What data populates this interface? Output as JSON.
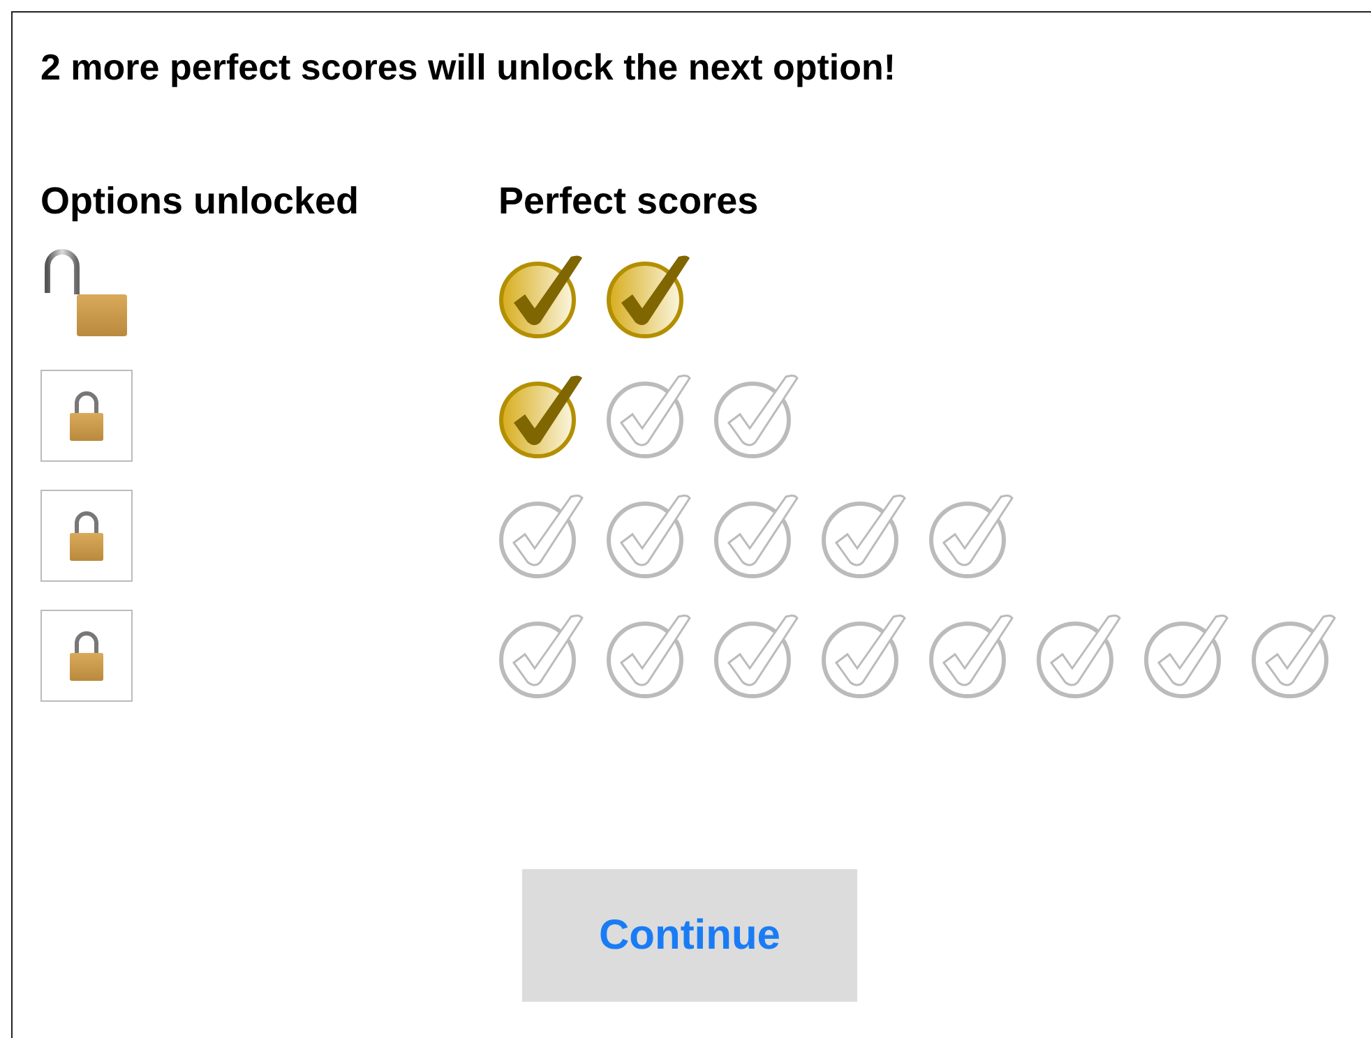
{
  "message": "2 more perfect scores will unlock the next option!",
  "headers": {
    "options": "Options unlocked",
    "scores": "Perfect scores"
  },
  "rows": [
    {
      "locked": false,
      "scores": [
        {
          "checked": true
        },
        {
          "checked": true
        }
      ]
    },
    {
      "locked": true,
      "scores": [
        {
          "checked": true
        },
        {
          "checked": false
        },
        {
          "checked": false
        }
      ]
    },
    {
      "locked": true,
      "scores": [
        {
          "checked": false
        },
        {
          "checked": false
        },
        {
          "checked": false
        },
        {
          "checked": false
        },
        {
          "checked": false
        }
      ]
    },
    {
      "locked": true,
      "scores": [
        {
          "checked": false
        },
        {
          "checked": false
        },
        {
          "checked": false
        },
        {
          "checked": false
        },
        {
          "checked": false
        },
        {
          "checked": false
        },
        {
          "checked": false
        },
        {
          "checked": false
        }
      ]
    }
  ],
  "button": "Continue"
}
